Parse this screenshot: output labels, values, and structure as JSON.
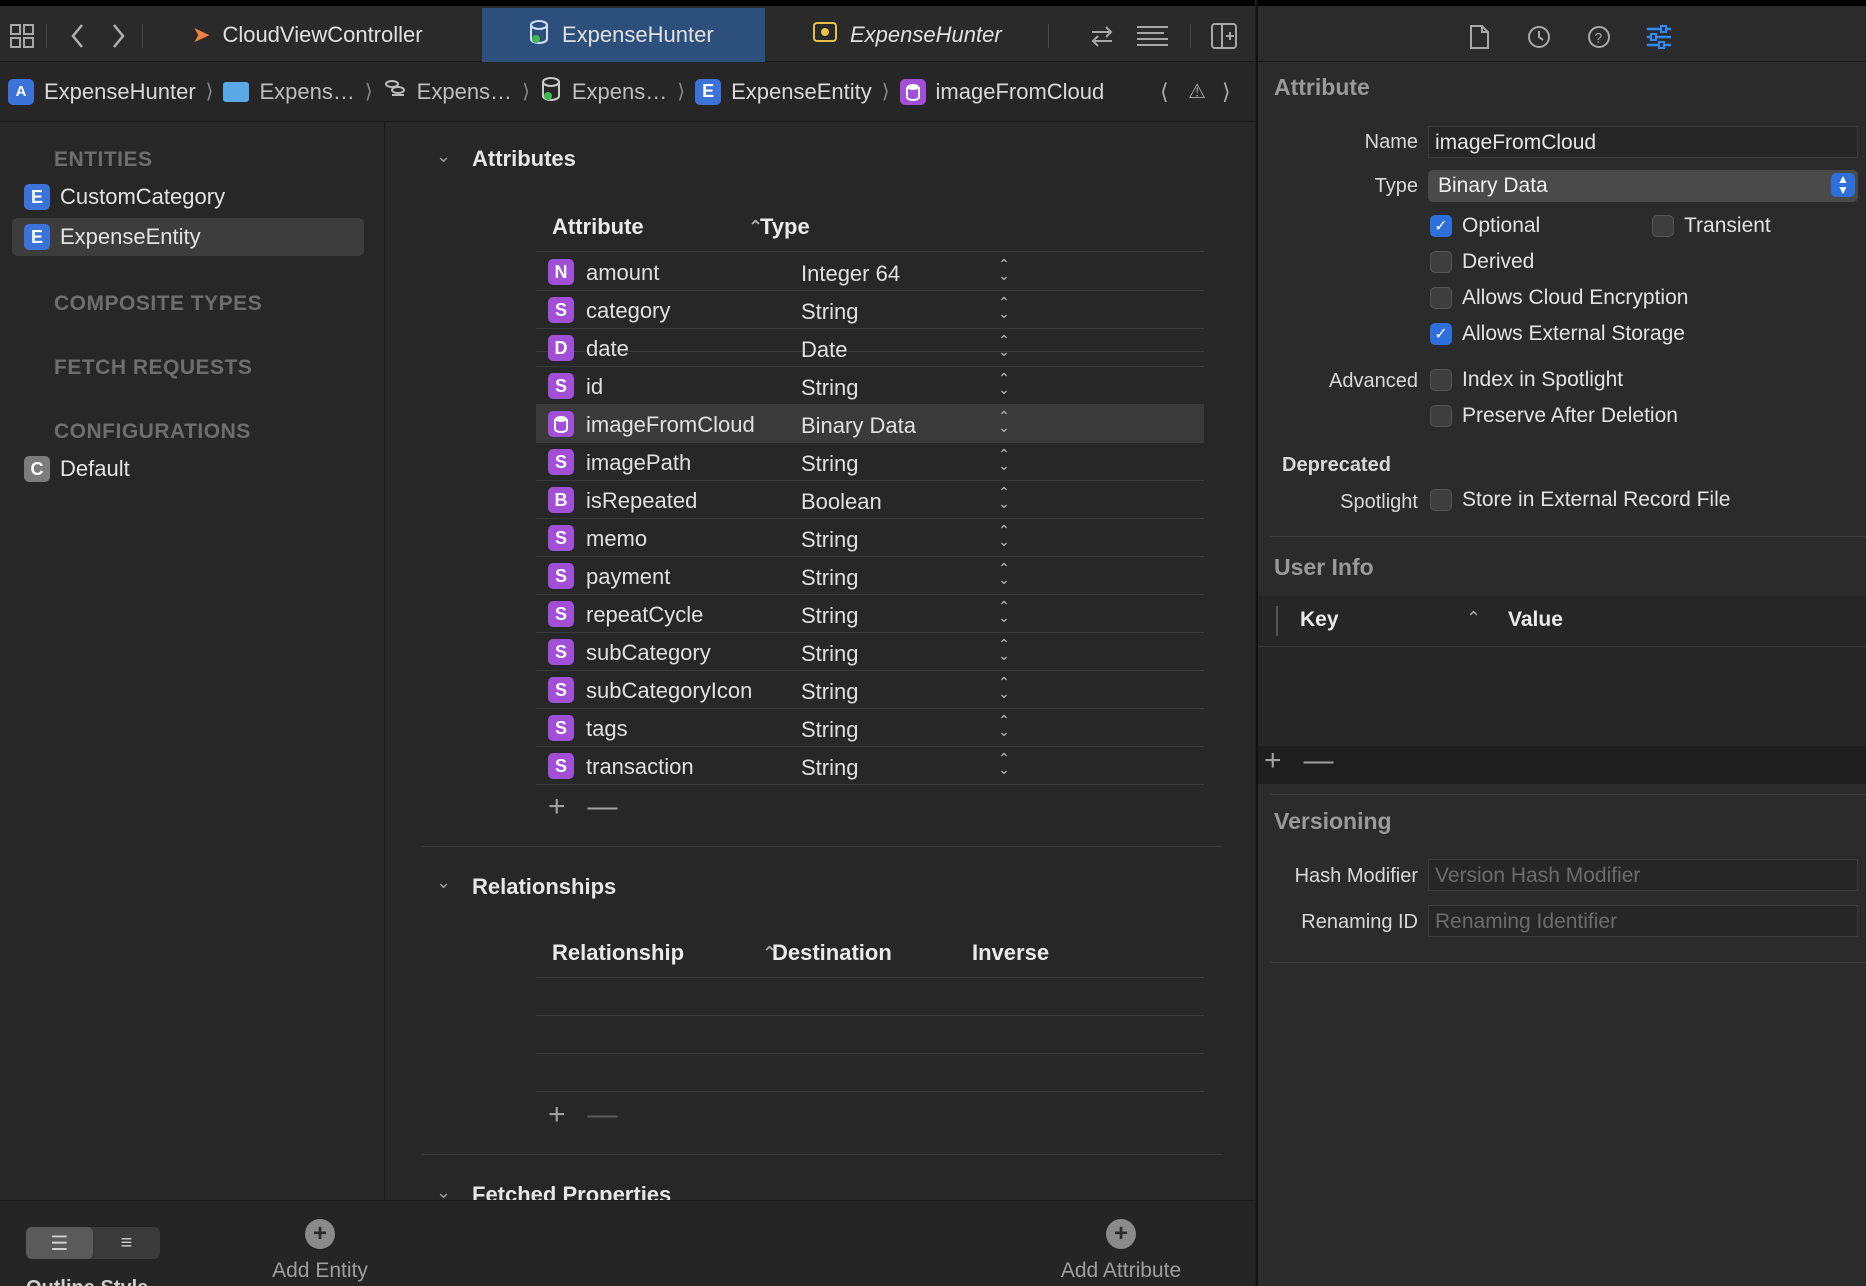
{
  "tabs": [
    {
      "label": "CloudViewController",
      "icon": "swift-icon",
      "active": false
    },
    {
      "label": "ExpenseHunter",
      "icon": "datamodel-icon",
      "active": true
    },
    {
      "label": "ExpenseHunter",
      "icon": "asset-icon",
      "active": false
    }
  ],
  "breadcrumbs": {
    "project": "ExpenseHunter",
    "folder": "Expens…",
    "group": "Expens…",
    "model": "Expens…",
    "entity": "ExpenseEntity",
    "attribute": "imageFromCloud"
  },
  "outline": {
    "entities_header": "ENTITIES",
    "entities": [
      {
        "badge": "E",
        "label": "CustomCategory"
      },
      {
        "badge": "E",
        "label": "ExpenseEntity"
      }
    ],
    "composite_header": "COMPOSITE TYPES",
    "fetch_header": "FETCH REQUESTS",
    "config_header": "CONFIGURATIONS",
    "configurations": [
      {
        "badge": "C",
        "label": "Default"
      }
    ]
  },
  "attributes": {
    "title": "Attributes",
    "col_attribute": "Attribute",
    "col_type": "Type",
    "rows": [
      {
        "badge": "N",
        "name": "amount",
        "type": "Integer 64"
      },
      {
        "badge": "S",
        "name": "category",
        "type": "String"
      },
      {
        "badge": "D",
        "name": "date",
        "type": "Date"
      },
      {
        "badge": "S",
        "name": "id",
        "type": "String"
      },
      {
        "badge": "",
        "name": "imageFromCloud",
        "type": "Binary Data"
      },
      {
        "badge": "S",
        "name": "imagePath",
        "type": "String"
      },
      {
        "badge": "B",
        "name": "isRepeated",
        "type": "Boolean"
      },
      {
        "badge": "S",
        "name": "memo",
        "type": "String"
      },
      {
        "badge": "S",
        "name": "payment",
        "type": "String"
      },
      {
        "badge": "S",
        "name": "repeatCycle",
        "type": "String"
      },
      {
        "badge": "S",
        "name": "subCategory",
        "type": "String"
      },
      {
        "badge": "S",
        "name": "subCategoryIcon",
        "type": "String"
      },
      {
        "badge": "S",
        "name": "tags",
        "type": "String"
      },
      {
        "badge": "S",
        "name": "transaction",
        "type": "String"
      }
    ]
  },
  "relationships": {
    "title": "Relationships",
    "col_relationship": "Relationship",
    "col_destination": "Destination",
    "col_inverse": "Inverse"
  },
  "fetched_properties": {
    "title": "Fetched Properties"
  },
  "bottom": {
    "outline_style": "Outline Style",
    "add_entity": "Add Entity",
    "add_attribute": "Add Attribute"
  },
  "inspector": {
    "title": "Attribute",
    "name_label": "Name",
    "name_value": "imageFromCloud",
    "type_label": "Type",
    "type_value": "Binary Data",
    "optional": "Optional",
    "transient": "Transient",
    "derived": "Derived",
    "cloud_encryption": "Allows Cloud Encryption",
    "external_storage": "Allows External Storage",
    "advanced_label": "Advanced",
    "index_spotlight": "Index in Spotlight",
    "preserve_deletion": "Preserve After Deletion",
    "deprecated_label": "Deprecated",
    "spotlight_label": "Spotlight",
    "store_external": "Store in External Record File",
    "user_info_title": "User Info",
    "col_key": "Key",
    "col_value": "Value",
    "versioning_title": "Versioning",
    "hash_label": "Hash Modifier",
    "hash_placeholder": "Version Hash Modifier",
    "renaming_label": "Renaming ID",
    "renaming_placeholder": "Renaming Identifier"
  },
  "colors": {
    "accent": "#2f6fdc",
    "badge_purple": "#a04fd6",
    "badge_blue": "#3b73d8"
  }
}
